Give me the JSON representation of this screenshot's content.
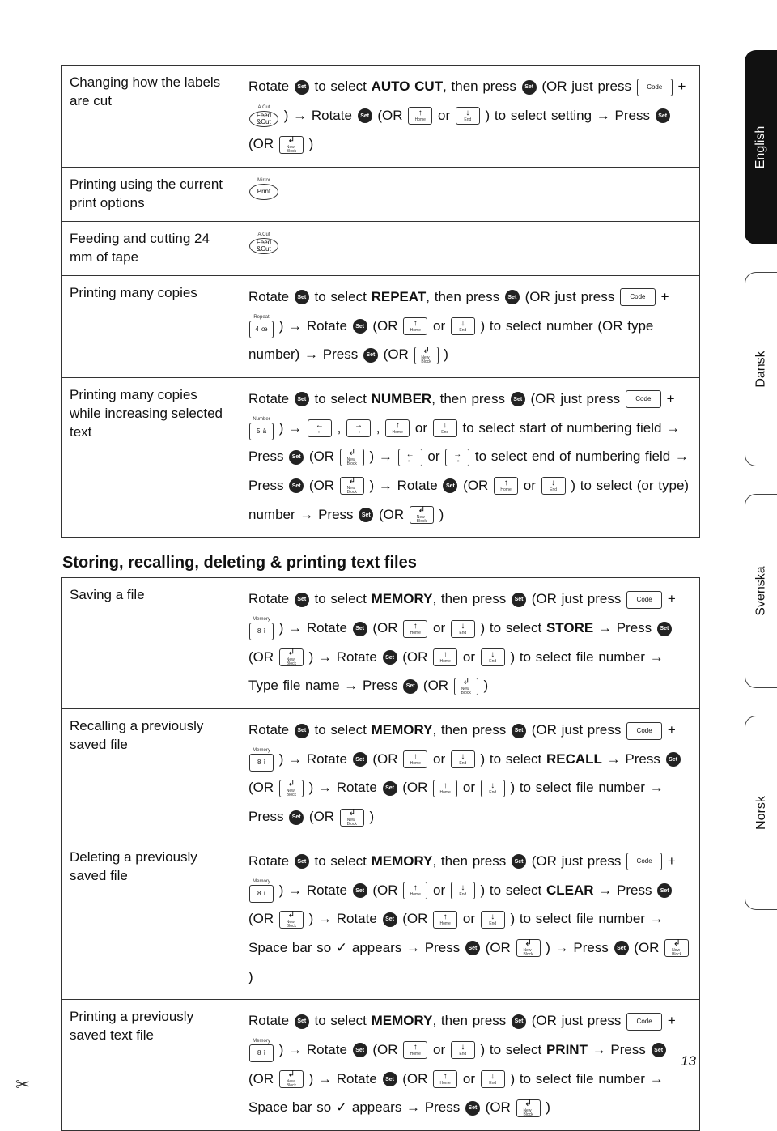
{
  "page_number": "13",
  "thumbs": [
    "English",
    "Dansk",
    "Svenska",
    "Norsk"
  ],
  "section2_title": "Storing, recalling, deleting & printing text files",
  "table1": {
    "rows": [
      {
        "label": "Changing how the labels are cut",
        "instr": "Rotate [Set] to select AUTO CUT, then press [Set] (OR just press [Code] + [Feed&Cut|A.Cut] ) → Rotate [Set] (OR [↑Home] or [↓End] ) to select setting → Press [Set] (OR [↲NewBlock] )"
      },
      {
        "label": "Printing using the current print options",
        "instr": "[Print|Mirror]"
      },
      {
        "label": "Feeding and cutting 24 mm of tape",
        "instr": "[Feed&Cut|A.Cut]"
      },
      {
        "label": "Printing many copies",
        "instr": "Rotate [Set] to select REPEAT, then press [Set] (OR just press [Code] + [4 œ|Repeat] ) → Rotate [Set] (OR [↑Home] or [↓End] ) to select number (OR type number) → Press [Set] (OR [↲NewBlock] )"
      },
      {
        "label": "Printing many copies while increasing selected text",
        "instr": "Rotate [Set] to select NUMBER, then press [Set] (OR just press [Code] + [5 à|Number] ) → [←] , [→] , [↑Home] or [↓End] to select start of numbering field → Press [Set] (OR [↲NewBlock] ) → [←] or [→] to select end of numbering field → Press [Set] (OR [↲NewBlock] ) → Rotate [Set] (OR [↑Home] or [↓End] ) to select (or type) number → Press [Set] (OR [↲NewBlock] )"
      }
    ]
  },
  "table2": {
    "rows": [
      {
        "label": "Saving a file",
        "instr": "Rotate [Set] to select MEMORY, then press [Set] (OR just press [Code] + [8 ì|Memory] ) → Rotate [Set] (OR [↑Home] or [↓End] ) to select STORE → Press [Set] (OR [↲NewBlock] ) → Rotate [Set] (OR [↑Home] or [↓End] ) to select file number → Type file name → Press [Set] (OR [↲NewBlock] )"
      },
      {
        "label": "Recalling a previously saved file",
        "instr": "Rotate [Set] to select MEMORY, then press [Set] (OR just press [Code] + [8 ì|Memory] ) → Rotate [Set] (OR [↑Home] or [↓End] ) to select RECALL → Press [Set] (OR [↲NewBlock] ) → Rotate [Set] (OR [↑Home] or [↓End] ) to select file number → Press [Set] (OR [↲NewBlock] )"
      },
      {
        "label": "Deleting a previously saved file",
        "instr": "Rotate [Set] to select MEMORY, then press [Set] (OR just press [Code] + [8 ì|Memory] ) → Rotate [Set] (OR [↑Home] or [↓End] ) to select CLEAR → Press [Set] (OR [↲NewBlock] ) → Rotate [Set] (OR [↑Home] or [↓End] ) to select file number → Space bar so ✓ appears → Press [Set] (OR [↲NewBlock] ) → Press [Set] (OR [↲NewBlock] )"
      },
      {
        "label": "Printing a previously saved text file",
        "instr": "Rotate [Set] to select MEMORY, then press [Set] (OR just press [Code] + [8 ì|Memory] ) → Rotate [Set] (OR [↑Home] or [↓End] ) to select PRINT → Press [Set] (OR [↲NewBlock] ) → Rotate [Set] (OR [↑Home] or [↓End] ) to select file number → Space bar so ✓ appears → Press [Set] (OR [↲NewBlock] )"
      }
    ]
  }
}
